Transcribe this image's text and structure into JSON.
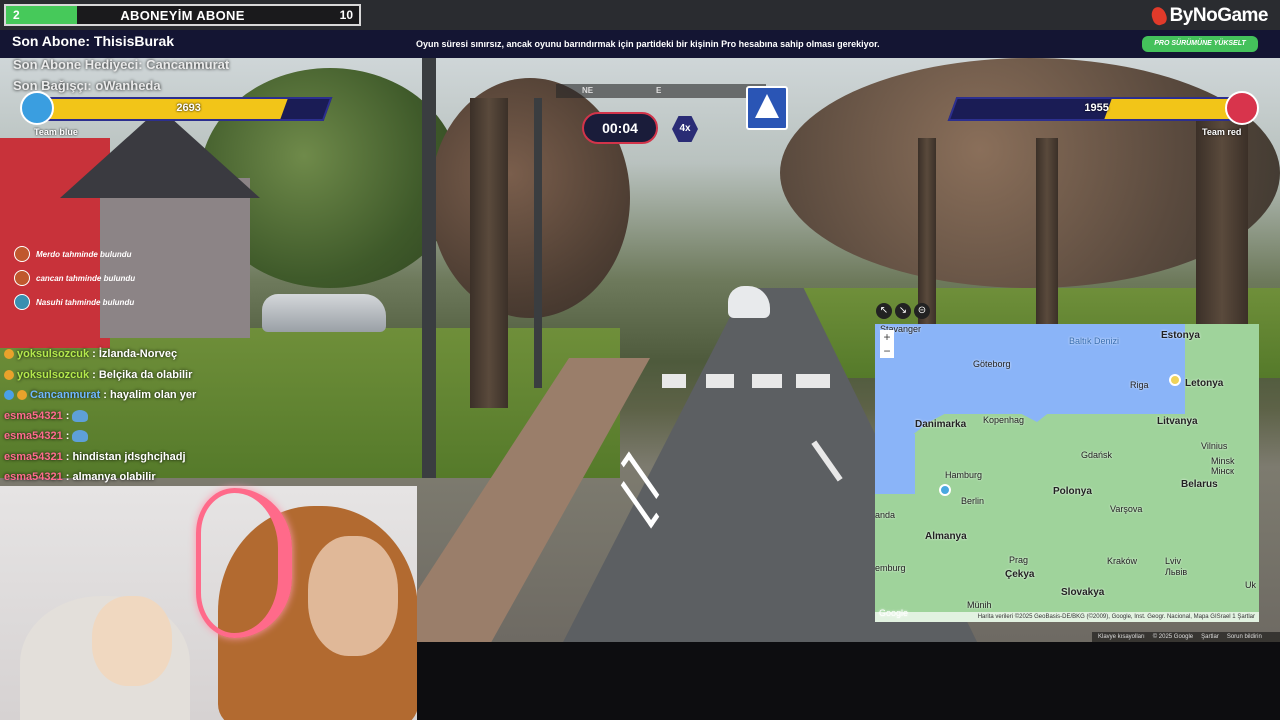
{
  "top_bar": {
    "subgoal_current": "2",
    "subgoal_label": "ABONEYİM ABONE",
    "subgoal_target": "10",
    "subgoal_progress": 0.2,
    "brand": "ByNoGame"
  },
  "notice_bar": {
    "last_sub": "Son Abone: ThisisBurak",
    "message": "Oyun süresi sınırsız, ancak oyunu barındırmak için partideki bir kişinin Pro hesabına sahip olması gerekiyor.",
    "pro_button": "PRO SÜRÜMÜNE YÜKSELT"
  },
  "overlay": {
    "last_gift": "Son Abone Hediyeci: Cancanmurat",
    "last_donor": "Son Bağışçı: oWanheda"
  },
  "game": {
    "team_blue": {
      "name": "Team blue",
      "score": "2693",
      "fill": 0.85
    },
    "team_red": {
      "name": "Team red",
      "score": "1955",
      "fill": 0.45
    },
    "timer": "00:04",
    "multiplier": "4x",
    "compass": {
      "labels": [
        "NE",
        "E"
      ]
    },
    "guesses": [
      {
        "text": "Merdo tahminde bulundu"
      },
      {
        "text": "cancan tahminde bulundu"
      },
      {
        "text": "Nasuhi tahminde bulundu"
      }
    ]
  },
  "chat": [
    {
      "user": "yoksulsozcuk",
      "message": ": İzlanda-Norveç",
      "color": "#b3e84c"
    },
    {
      "user": "yoksulsozcuk",
      "message": ": Belçika da olabilir",
      "color": "#b3e84c"
    },
    {
      "user": "Cancanmurat",
      "message": ": hayalim olan yer",
      "color": "#6fb7ff"
    },
    {
      "user": "esma54321",
      "message": ":",
      "color": "#ff6b8f"
    },
    {
      "user": "esma54321",
      "message": ":",
      "color": "#ff6b8f"
    },
    {
      "user": "esma54321",
      "message": ": hindistan jdsghcjhadj",
      "color": "#ff6b8f"
    },
    {
      "user": "esma54321",
      "message": ": almanya olabilir",
      "color": "#ff6b8f"
    }
  ],
  "map": {
    "sea_label": "Baltık Denizi",
    "countries": [
      "Estonya",
      "Danimarka",
      "Litvanya",
      "Polonya",
      "Belarus",
      "Almanya",
      "Çekya",
      "Slovakya",
      "Letonya"
    ],
    "cities": [
      "Stavanger",
      "Göteborg",
      "Riga",
      "Kopenhag",
      "Vilnius",
      "Gdańsk",
      "Minsk",
      "Мінск",
      "Hamburg",
      "Berlin",
      "Varşova",
      "Prag",
      "Kraków",
      "Lviv",
      "Львів",
      "Münih",
      "Uk"
    ],
    "extra_labels": [
      "anda",
      "emburg"
    ],
    "attribution": "Harita verileri ©2025 GeoBasis-DE/BKG (©2009), Google, Inst. Geogr. Nacional, Mapa GISrael 1 Şartlar",
    "google": "Google"
  },
  "footer": {
    "items": [
      "Klavye kısayolları",
      "© 2025 Google",
      "Şartlar",
      "Sorun bildirin"
    ]
  }
}
